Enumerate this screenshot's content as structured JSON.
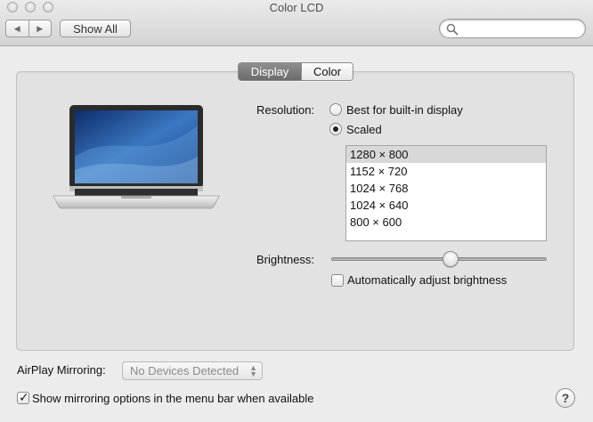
{
  "window": {
    "title": "Color LCD"
  },
  "toolbar": {
    "back_icon": "back-arrow-icon",
    "forward_icon": "forward-arrow-icon",
    "show_all_label": "Show All",
    "search": {
      "value": "",
      "placeholder": ""
    }
  },
  "tabs": [
    {
      "label": "Display",
      "selected": true
    },
    {
      "label": "Color",
      "selected": false
    }
  ],
  "resolution": {
    "label": "Resolution:",
    "options": [
      {
        "label": "Best for built-in display",
        "selected": false
      },
      {
        "label": "Scaled",
        "selected": true
      }
    ],
    "list": [
      "1280 × 800",
      "1152 × 720",
      "1024 × 768",
      "1024 × 640",
      "800 × 600"
    ],
    "selected_index": 0
  },
  "brightness": {
    "label": "Brightness:",
    "level": 0.56,
    "auto_label": "Automatically adjust brightness",
    "auto_checked": false
  },
  "airplay": {
    "label": "AirPlay Mirroring:",
    "value": "No Devices Detected"
  },
  "mirroring_option": {
    "label": "Show mirroring options in the menu bar when available",
    "checked": true
  },
  "help_label": "?"
}
